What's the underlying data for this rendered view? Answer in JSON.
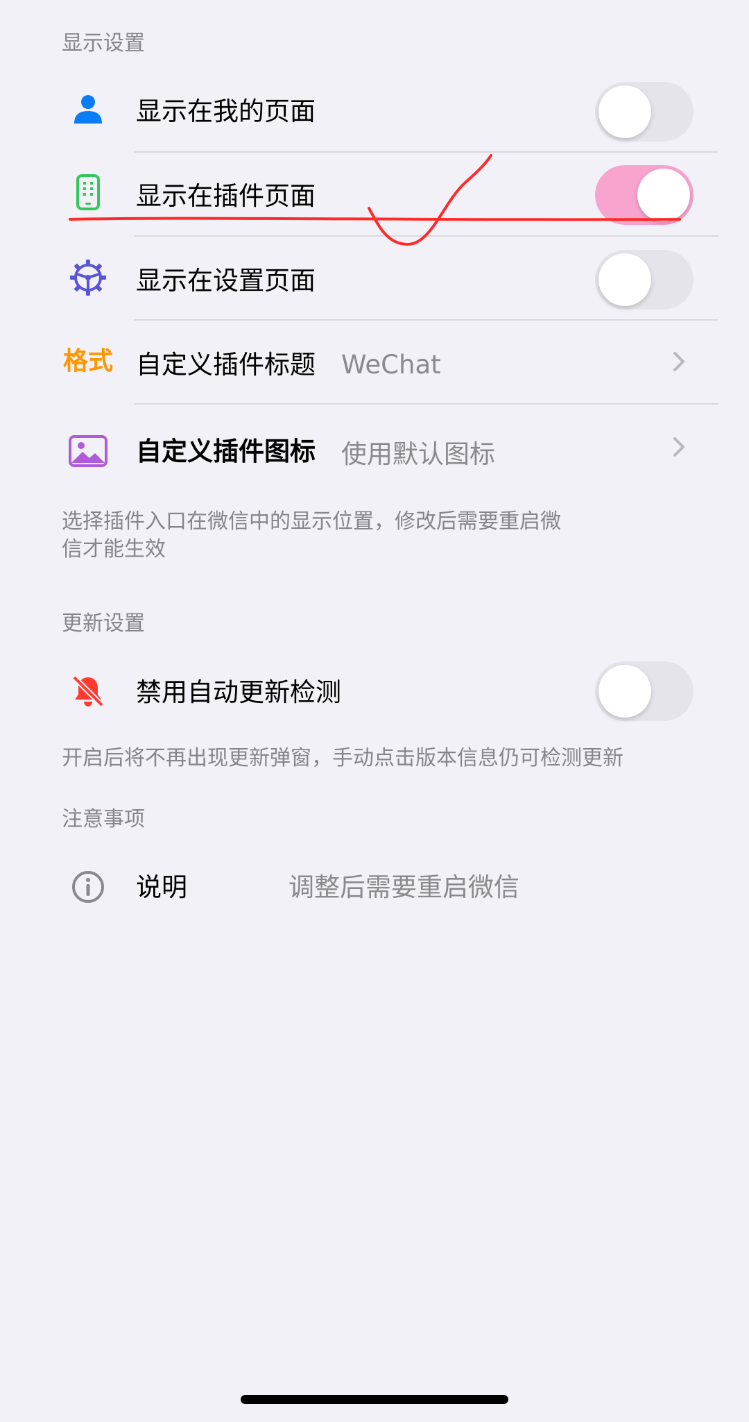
{
  "display_settings": {
    "header": "显示设置",
    "rows": [
      {
        "label": "显示在我的页面",
        "icon": "person-icon",
        "toggle": false
      },
      {
        "label": "显示在插件页面",
        "icon": "phone-icon",
        "toggle": true
      },
      {
        "label": "显示在设置页面",
        "icon": "steering-wheel-gear-icon",
        "toggle": false
      },
      {
        "icon_text": "格式",
        "label": "自定义插件标题",
        "value": "WeChat"
      },
      {
        "label": "自定义插件图标",
        "icon": "photo-icon",
        "value": "使用默认图标"
      }
    ],
    "footer_line1": "选择插件入口在微信中的显示位置，修改后需要重启微",
    "footer_line2": "信才能生效"
  },
  "update_settings": {
    "header": "更新设置",
    "row": {
      "label": "禁用自动更新检测",
      "icon": "bell-slash-icon",
      "toggle": false
    },
    "footer": "开启后将不再出现更新弹窗，手动点击版本信息仍可检测更新"
  },
  "notes": {
    "header": "注意事项",
    "row": {
      "label": "说明",
      "icon": "info-circle-icon",
      "value": "调整后需要重启微信"
    }
  },
  "colors": {
    "background": "#f2f1f7",
    "toggle_on": "#f7a4cf",
    "toggle_off": "#e5e4ea",
    "accent_blue": "#0a7cf6",
    "accent_green": "#34c759",
    "accent_indigo": "#5a55d6",
    "accent_orange": "#ff9500",
    "accent_purple": "#b05cd9",
    "accent_red": "#ff3b30",
    "annotation_red": "#ff2a2a"
  }
}
